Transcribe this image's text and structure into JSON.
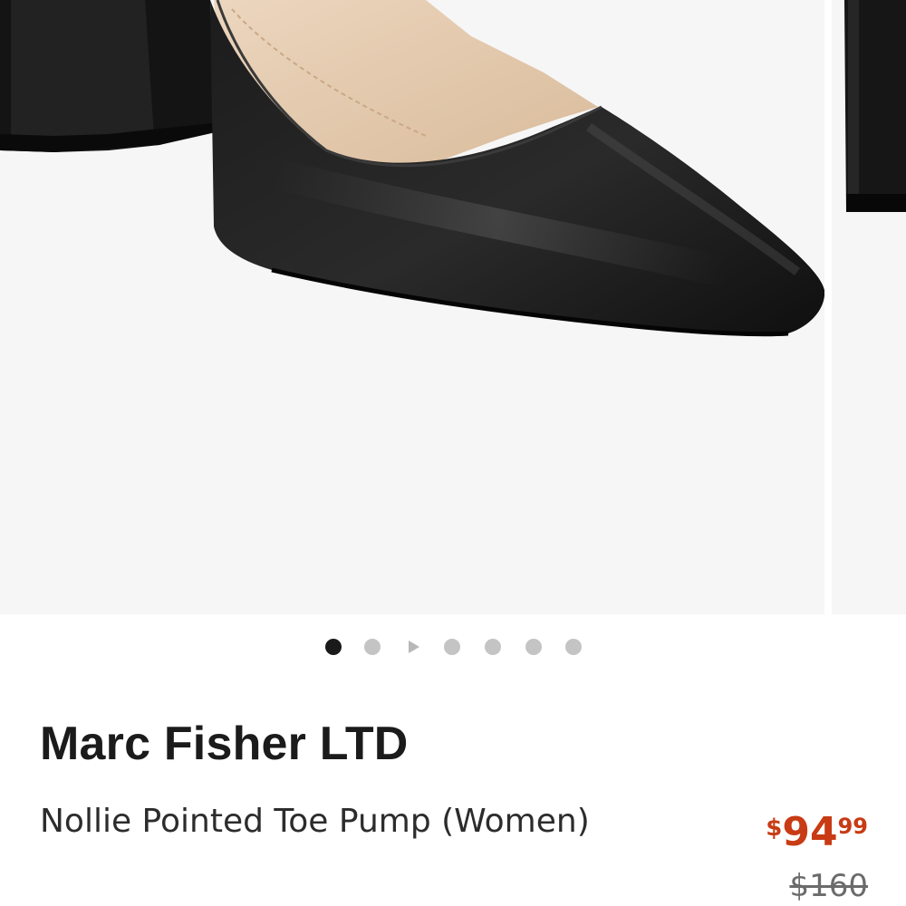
{
  "carousel": {
    "main_image": "black leather pointed toe block heel pump",
    "next_image": "shoe heel partial",
    "dots": [
      {
        "type": "dot",
        "active": true
      },
      {
        "type": "dot",
        "active": false
      },
      {
        "type": "video",
        "active": false
      },
      {
        "type": "dot",
        "active": false
      },
      {
        "type": "dot",
        "active": false
      },
      {
        "type": "dot",
        "active": false
      },
      {
        "type": "dot",
        "active": false
      }
    ]
  },
  "product": {
    "brand": "Marc Fisher LTD",
    "name": "Nollie Pointed Toe Pump (Women)",
    "price": {
      "currency": "$",
      "dollars": "94",
      "cents": "99"
    },
    "original_price": "$160"
  },
  "colors": {
    "price": "#c83b14",
    "text": "#1b1b1b",
    "dot_active": "#1a1a1a",
    "dot_inactive": "#c4c4c4",
    "image_background": "#f6f6f6"
  }
}
